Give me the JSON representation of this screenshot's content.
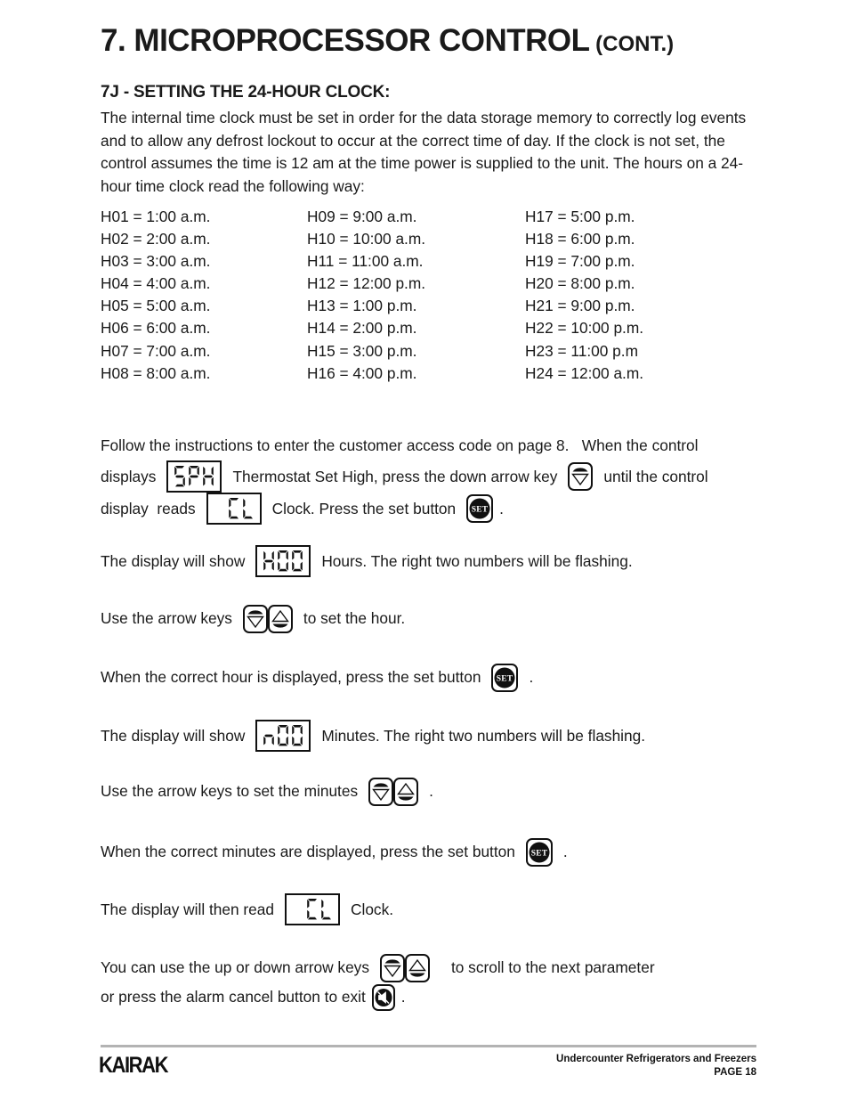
{
  "header": {
    "title_main": "7. MICROPROCESSOR CONTROL",
    "title_cont": "(CONT.)",
    "section_heading": "7J - SETTING THE 24-HOUR CLOCK:"
  },
  "intro": {
    "paragraph": "The internal time clock must be set in order for the data storage memory to correctly log events and to allow any defrost lockout to occur at the correct time of day. If the clock is not set, the control assumes the time is 12 am at the time power is supplied to the unit. The hours on a 24-hour time clock read the following way:"
  },
  "hours_table": {
    "column1": [
      "H01 = 1:00 a.m.",
      "H02 = 2:00 a.m.",
      "H03 = 3:00 a.m.",
      "H04 = 4:00 a.m.",
      "H05 = 5:00 a.m.",
      "H06 = 6:00 a.m.",
      "H07 = 7:00 a.m.",
      "H08 = 8:00 a.m."
    ],
    "column2": [
      "H09 = 9:00 a.m.",
      "H10 = 10:00 a.m.",
      "H11 = 11:00 a.m.",
      "H12 = 12:00 p.m.",
      "H13 = 1:00 p.m.",
      "H14 = 2:00 p.m.",
      "H15 = 3:00 p.m.",
      "H16 = 4:00 p.m."
    ],
    "column3": [
      "H17 = 5:00 p.m.",
      "H18 = 6:00 p.m.",
      "H19 = 7:00 p.m.",
      "H20 = 8:00 p.m.",
      "H21 = 9:00 p.m.",
      "H22 = 10:00 p.m.",
      "H23 = 11:00 p.m",
      "H24 = 12:00 a.m."
    ]
  },
  "steps": {
    "step1": {
      "line1": "Follow the instructions to enter the customer access code on page 8.   When the control",
      "line2_a": "displays",
      "display_value": "SPH",
      "line2_b": "Thermostat Set High, press the down arrow key",
      "line2_c": "until the control",
      "line3_a": "display  reads",
      "display_value2": "CL",
      "line3_b": "Clock. Press the set button",
      "line3_c": "."
    },
    "step2": {
      "text_a": "The display will show",
      "display_value": "H00",
      "text_b": "Hours. The right two numbers will be flashing."
    },
    "step3": {
      "text_a": "Use the arrow keys",
      "text_b": "to set the hour."
    },
    "step4": {
      "text_a": "When the correct hour is displayed, press the set button",
      "text_b": "."
    },
    "step5": {
      "text_a": "The display will show",
      "display_value": "n00",
      "text_b": "Minutes. The right two numbers will be flashing."
    },
    "step6": {
      "text_a": "Use the arrow keys to set the minutes",
      "text_b": "."
    },
    "step7": {
      "text_a": "When the correct minutes are displayed, press the set button",
      "text_b": "."
    },
    "step8": {
      "text_a": "The display will then read",
      "display_value": "CL",
      "text_b": "Clock."
    },
    "step9": {
      "line1_a": "You can use the up or down arrow keys",
      "line1_b": "to scroll to the next parameter",
      "line2_a": "or press the alarm cancel button to exit",
      "line2_b": "."
    }
  },
  "buttons": {
    "set_label": "SET"
  },
  "footer": {
    "logo": "KAIRAK",
    "product_line": "Undercounter Refrigerators and Freezers",
    "page_label": "PAGE 18"
  },
  "colors": {
    "ink": "#1a1a1a",
    "rule": "#b3b3b3",
    "white": "#ffffff"
  }
}
